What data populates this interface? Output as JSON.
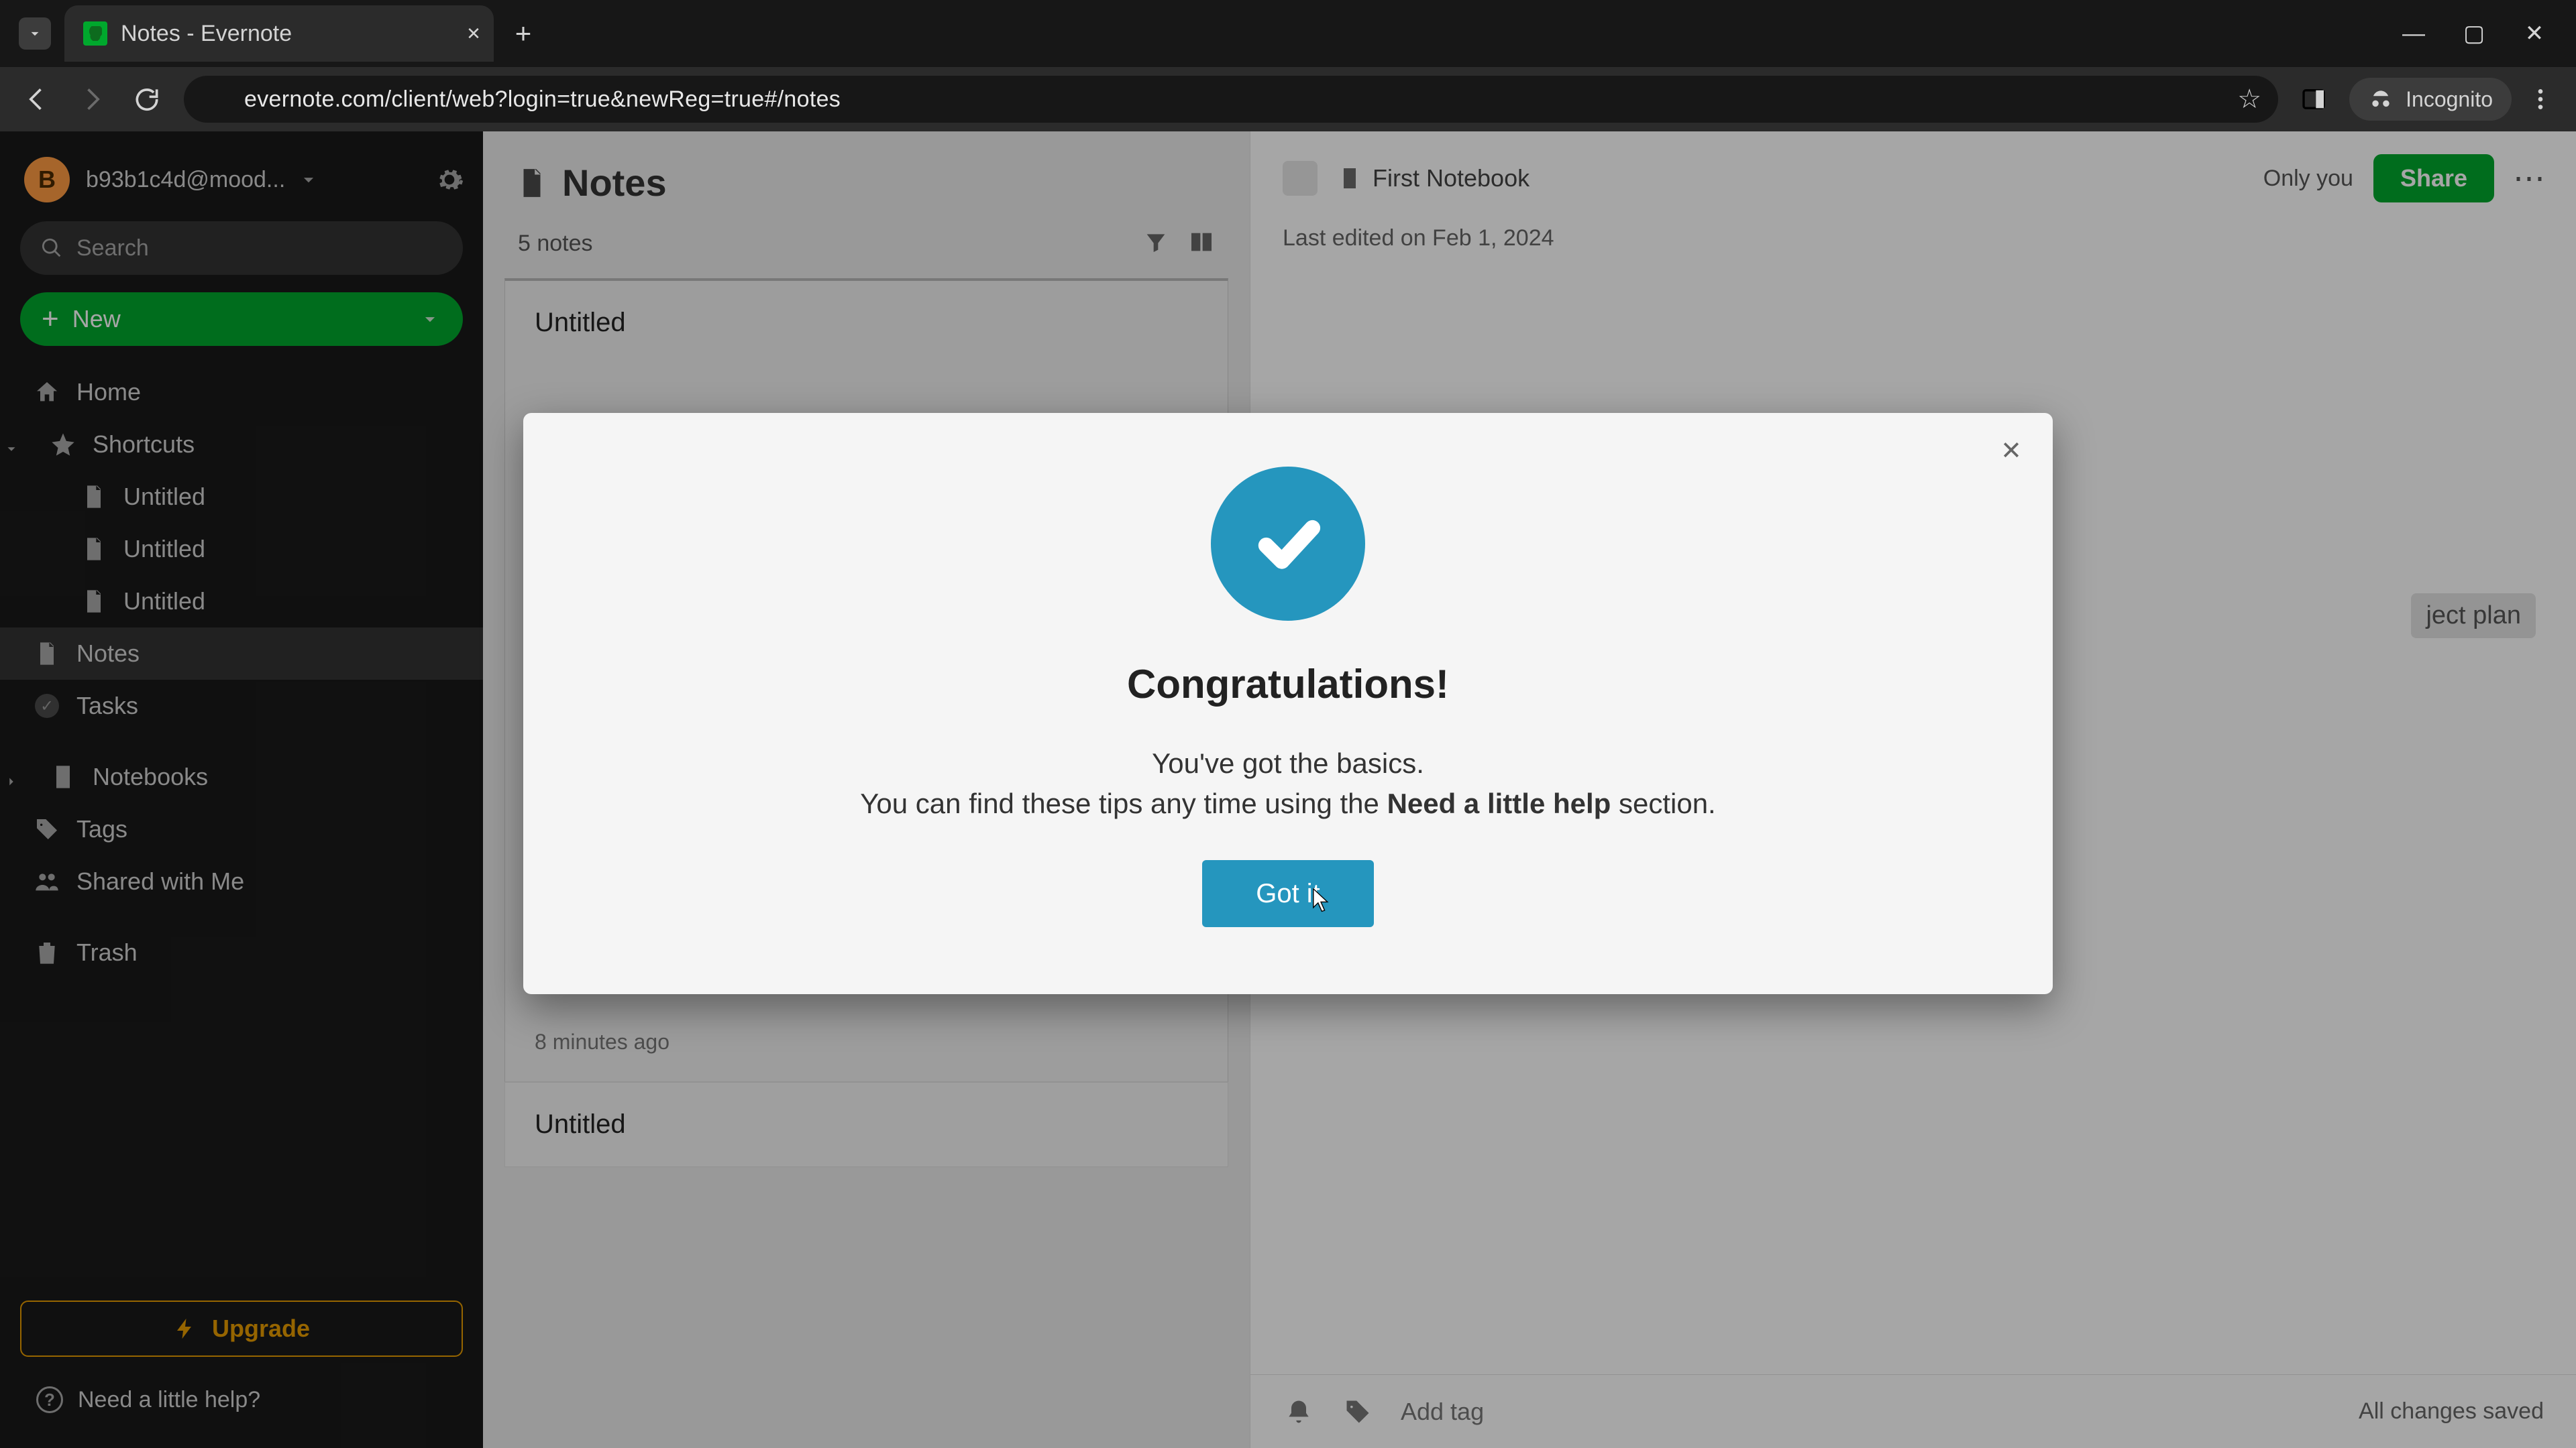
{
  "browser": {
    "tab_title": "Notes - Evernote",
    "url": "evernote.com/client/web?login=true&newReg=true#/notes",
    "incognito_label": "Incognito"
  },
  "sidebar": {
    "avatar_letter": "B",
    "account_name": "b93b1c4d@mood...",
    "search_placeholder": "Search",
    "new_label": "New",
    "items": {
      "home": "Home",
      "shortcuts": "Shortcuts",
      "notes": "Notes",
      "tasks": "Tasks",
      "notebooks": "Notebooks",
      "tags": "Tags",
      "shared": "Shared with Me",
      "trash": "Trash"
    },
    "shortcuts_children": [
      "Untitled",
      "Untitled",
      "Untitled"
    ],
    "upgrade_label": "Upgrade",
    "help_label": "Need a little help?"
  },
  "notes": {
    "title": "Notes",
    "count_label": "5 notes",
    "items": [
      {
        "title": "Untitled",
        "age": "8 minutes ago"
      },
      {
        "title": "Untitled",
        "age": ""
      }
    ]
  },
  "editor": {
    "notebook": "First Notebook",
    "visibility": "Only you",
    "share_label": "Share",
    "last_edited": "Last edited on Feb 1, 2024",
    "ghost_chip": "ject plan",
    "add_tag_label": "Add tag",
    "save_status": "All changes saved"
  },
  "modal": {
    "heading": "Congratulations!",
    "line1": "You've got the basics.",
    "line2_pre": "You can find these tips any time using the ",
    "line2_bold": "Need a little help",
    "line2_post": " section.",
    "button": "Got it"
  }
}
